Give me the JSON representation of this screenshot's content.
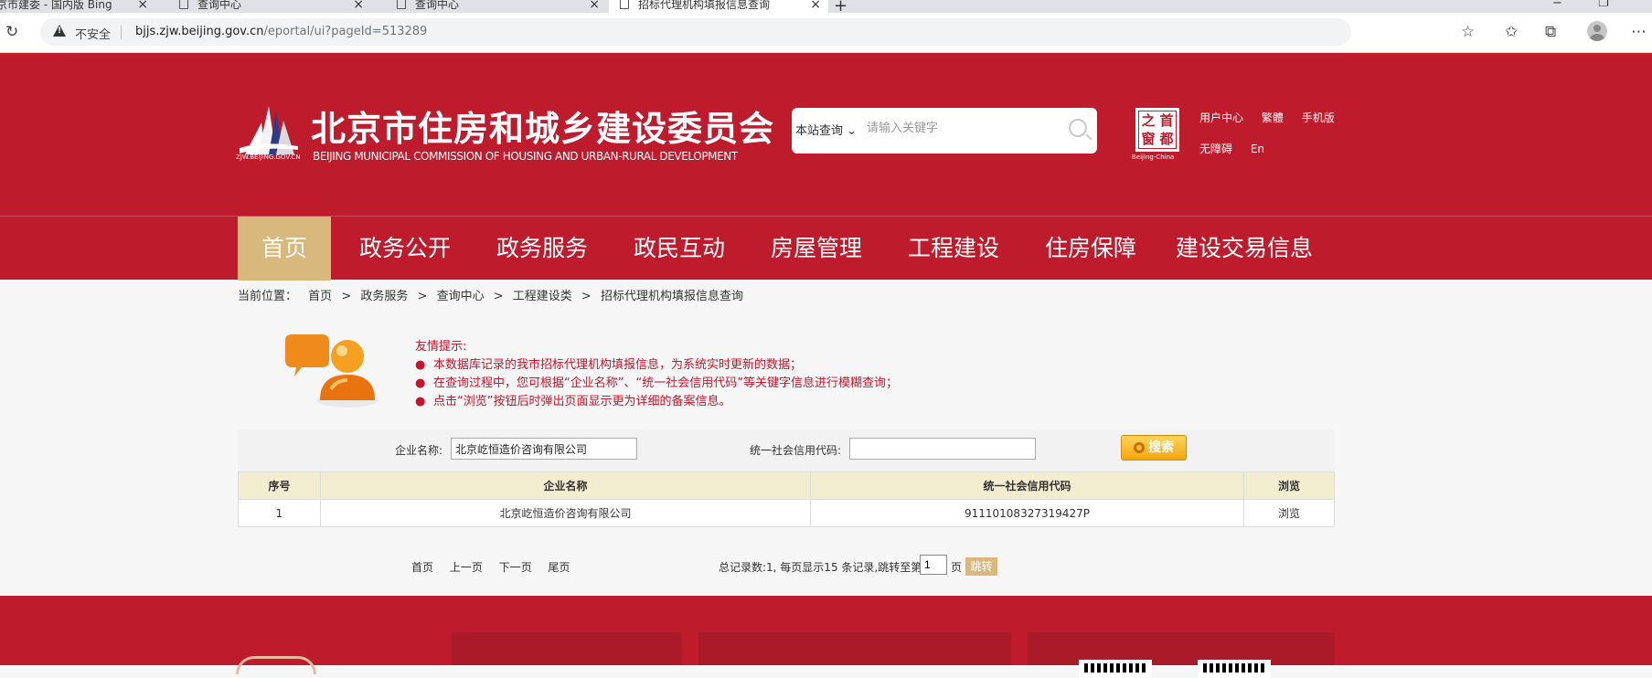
{
  "browser": {
    "tabs": [
      {
        "label": "京市建委 - 国内版 Bing"
      },
      {
        "label": "查询中心"
      },
      {
        "label": "查询中心"
      },
      {
        "label": "招标代理机构填报信息查询"
      }
    ],
    "new_tab": "+",
    "security_label": "不安全",
    "url_host": "bjjs.zjw.beijing.gov.cn",
    "url_path": "/eportal/ui?pageId=513289"
  },
  "header": {
    "logo_sub": "ZJW.BEIJING.GOV.CN",
    "title": "北京市住房和城乡建设委员会",
    "title_en": "BEIJING MUNICIPAL COMMISSION OF HOUSING AND URBAN-RURAL DEVELOPMENT",
    "search_scope": "本站查询",
    "search_placeholder": "请输入关键字",
    "seal_chars": [
      "之",
      "首",
      "窗",
      "都"
    ],
    "seal_sub": "Beijing-China",
    "links_row1": [
      "用户中心",
      "繁體",
      "手机版"
    ],
    "links_row2": [
      "无障碍",
      "En"
    ]
  },
  "nav": {
    "items": [
      "首页",
      "政务公开",
      "政务服务",
      "政民互动",
      "房屋管理",
      "工程建设",
      "住房保障",
      "建设交易信息"
    ]
  },
  "breadcrumb": {
    "prefix": "当前位置：",
    "items": [
      "首页",
      "政务服务",
      "查询中心",
      "工程建设类",
      "招标代理机构填报信息查询"
    ],
    "sep": ">"
  },
  "tips": {
    "title": "友情提示:",
    "bullet": "●",
    "lines": [
      "本数据库记录的我市招标代理机构填报信息，为系统实时更新的数据；",
      "在查询过程中，您可根据“企业名称”、“统一社会信用代码”等关键字信息进行模糊查询；",
      "点击“浏览”按钮后时弹出页面显示更为详细的备案信息。"
    ]
  },
  "query": {
    "company_label": "企业名称:",
    "company_value": "北京屹恒造价咨询有限公司",
    "credit_label": "统一社会信用代码:",
    "credit_value": "",
    "search_button": "搜索"
  },
  "results": {
    "headers": [
      "序号",
      "企业名称",
      "统一社会信用代码",
      "浏览"
    ],
    "rows": [
      [
        "1",
        "北京屹恒造价咨询有限公司",
        "91110108327319427P",
        "浏览"
      ]
    ]
  },
  "pager": {
    "first": "首页",
    "prev": "上一页",
    "next": "下一页",
    "last": "尾页",
    "info": "总记录数:1, 每页显示15 条记录,跳转至第",
    "page_value": "1",
    "page_word": "页",
    "jump": "跳转"
  },
  "colors": {
    "brand_red": "#be1b2d",
    "nav_active": "#d9b87e",
    "tip_text": "#c8142c"
  }
}
